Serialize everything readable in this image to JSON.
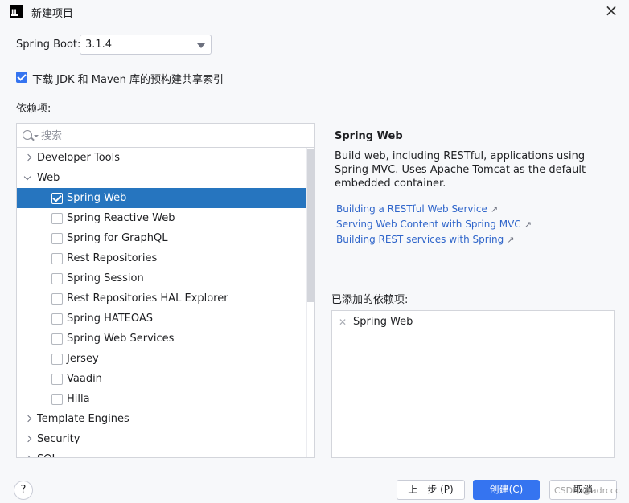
{
  "window": {
    "title": "新建项目"
  },
  "spring_boot": {
    "label": "Spring Boot:",
    "selected": "3.1.4"
  },
  "download_index": {
    "label": "下载 JDK 和 Maven 库的预构建共享索引",
    "checked": true
  },
  "dependencies_label": "依赖项:",
  "search": {
    "placeholder": "搜索"
  },
  "tree": [
    {
      "kind": "group",
      "label": "Developer Tools",
      "expanded": false
    },
    {
      "kind": "group",
      "label": "Web",
      "expanded": true
    },
    {
      "kind": "item",
      "label": "Spring Web",
      "checked": true,
      "selected": true
    },
    {
      "kind": "item",
      "label": "Spring Reactive Web",
      "checked": false
    },
    {
      "kind": "item",
      "label": "Spring for GraphQL",
      "checked": false
    },
    {
      "kind": "item",
      "label": "Rest Repositories",
      "checked": false
    },
    {
      "kind": "item",
      "label": "Spring Session",
      "checked": false
    },
    {
      "kind": "item",
      "label": "Rest Repositories HAL Explorer",
      "checked": false
    },
    {
      "kind": "item",
      "label": "Spring HATEOAS",
      "checked": false
    },
    {
      "kind": "item",
      "label": "Spring Web Services",
      "checked": false
    },
    {
      "kind": "item",
      "label": "Jersey",
      "checked": false
    },
    {
      "kind": "item",
      "label": "Vaadin",
      "checked": false
    },
    {
      "kind": "item",
      "label": "Hilla",
      "checked": false
    },
    {
      "kind": "group",
      "label": "Template Engines",
      "expanded": false
    },
    {
      "kind": "group",
      "label": "Security",
      "expanded": false
    },
    {
      "kind": "group",
      "label": "SQL",
      "expanded": false
    }
  ],
  "detail": {
    "title": "Spring Web",
    "description": "Build web, including RESTful, applications using Spring MVC. Uses Apache Tomcat as the default embedded container.",
    "links": [
      "Building a RESTful Web Service",
      "Serving Web Content with Spring MVC",
      "Building REST services with Spring"
    ]
  },
  "added": {
    "label": "已添加的依赖项:",
    "items": [
      "Spring Web"
    ]
  },
  "footer": {
    "help": "?",
    "prev": "上一步 (P)",
    "create": "创建(C)",
    "cancel": "取消",
    "watermark": "CSDN @adrccc"
  },
  "colors": {
    "accent": "#3574f0",
    "selection": "#2675bf",
    "link": "#2f65ca"
  }
}
